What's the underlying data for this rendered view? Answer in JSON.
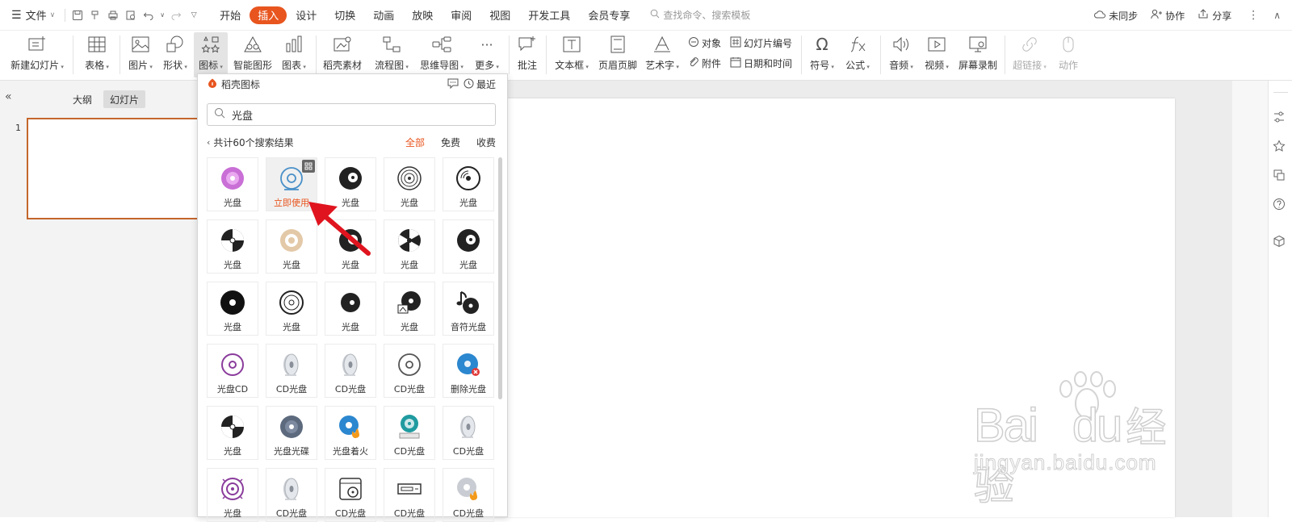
{
  "menubar": {
    "file_label": "文件",
    "tabs": [
      "开始",
      "插入",
      "设计",
      "切换",
      "动画",
      "放映",
      "审阅",
      "视图",
      "开发工具",
      "会员专享"
    ],
    "active_tab": "插入",
    "search_placeholder": "查找命令、搜索模板",
    "unsync": "未同步",
    "collab": "协作",
    "share": "分享"
  },
  "ribbon": {
    "new_slide": "新建幻灯片",
    "table": "表格",
    "picture": "图片",
    "shape": "形状",
    "icon": "图标",
    "smartart": "智能图形",
    "chart": "图表",
    "docer": "稻壳素材",
    "flowchart": "流程图",
    "mindmap": "思维导图",
    "more": "更多",
    "comment": "批注",
    "textbox": "文本框",
    "header_footer": "页眉页脚",
    "wordart": "艺术字",
    "object": "对象",
    "slide_number": "幻灯片编号",
    "attachment": "附件",
    "datetime": "日期和时间",
    "symbol": "符号",
    "formula": "公式",
    "audio": "音频",
    "video": "视频",
    "screen_record": "屏幕录制",
    "hyperlink": "超链接",
    "action": "动作"
  },
  "leftpane": {
    "outline_tab": "大纲",
    "slides_tab": "幻灯片",
    "slide_num": "1"
  },
  "iconpanel": {
    "title": "稻壳图标",
    "recent": "最近",
    "search_value": "光盘",
    "result_text": "共计60个搜索结果",
    "filters": [
      "全部",
      "免费",
      "收费"
    ],
    "active_filter": "全部",
    "use_now": "立即使用",
    "icons": [
      "光盘",
      "立即使用",
      "光盘",
      "光盘",
      "光盘",
      "光盘",
      "光盘",
      "光盘",
      "光盘",
      "光盘",
      "光盘",
      "光盘",
      "光盘",
      "光盘",
      "音符光盘",
      "光盘CD",
      "CD光盘",
      "CD光盘",
      "CD光盘",
      "删除光盘",
      "光盘",
      "光盘光碟",
      "光盘着火",
      "CD光盘",
      "CD光盘",
      "光盘",
      "CD光盘",
      "CD光盘",
      "CD光盘",
      "CD光盘"
    ]
  },
  "watermark": {
    "brand": "Bai",
    "brand2": "du",
    "cn": "经验",
    "url": "jingyan.baidu.com"
  },
  "colors": {
    "accent": "#e8551e",
    "thumb_border": "#c4662c",
    "arrow": "#e0141e"
  }
}
